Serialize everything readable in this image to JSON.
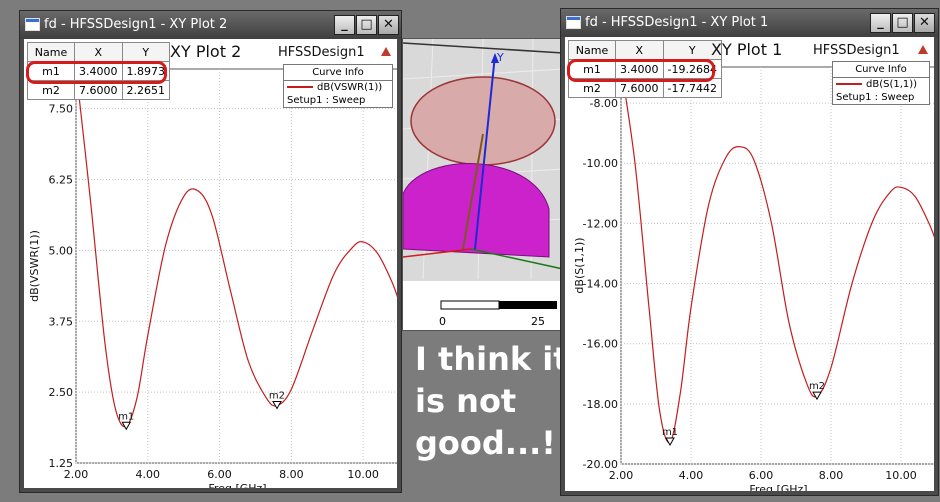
{
  "windows": [
    {
      "title": "fd - HFSSDesign1 - XY Plot 2",
      "plot_title": "XY Plot 2",
      "design": "HFSSDesign1",
      "markers": {
        "headers": [
          "Name",
          "X",
          "Y"
        ],
        "rows": [
          [
            "m1",
            "3.4000",
            "1.8973"
          ],
          [
            "m2",
            "7.6000",
            "2.2651"
          ]
        ],
        "highlighted_row": "m1",
        "highlight_color": "#d61b1b"
      },
      "curve_info": {
        "header": "Curve Info",
        "trace": "dB(VSWR(1))",
        "setup": "Setup1 : Sweep"
      }
    },
    {
      "title": "fd - HFSSDesign1 - XY Plot 1",
      "plot_title": "XY Plot 1",
      "design": "HFSSDesign1",
      "markers": {
        "headers": [
          "Name",
          "X",
          "Y"
        ],
        "rows": [
          [
            "m1",
            "3.4000",
            "-19.2684"
          ],
          [
            "m2",
            "7.6000",
            "-17.7442"
          ]
        ],
        "highlighted_row": "m1",
        "highlight_color": "#d61b1b"
      },
      "curve_info": {
        "header": "Curve Info",
        "trace": "dB(S(1,1))",
        "setup": "Setup1 : Sweep"
      }
    }
  ],
  "chart_data": [
    {
      "type": "line",
      "xlabel": "Freq [GHz]",
      "ylabel": "dB(VSWR(1))",
      "xlim": [
        2.0,
        11.0
      ],
      "ylim": [
        1.25,
        8.2
      ],
      "xticks": [
        "2.00",
        "4.00",
        "6.00",
        "8.00",
        "10.00"
      ],
      "yticks": [
        "1.25",
        "2.50",
        "3.75",
        "5.00",
        "6.25",
        "7.50"
      ],
      "grid": true,
      "line_color": "#c31d1d",
      "series": [
        {
          "name": "dB(VSWR(1))",
          "x": [
            2.0,
            2.4,
            2.8,
            3.1,
            3.4,
            3.7,
            4.0,
            4.5,
            5.0,
            5.4,
            5.8,
            6.3,
            6.8,
            7.3,
            7.6,
            8.0,
            8.6,
            9.2,
            9.7,
            10.0,
            10.4,
            10.8,
            11.0
          ],
          "y": [
            8.2,
            5.9,
            3.4,
            2.2,
            1.8973,
            2.4,
            3.5,
            5.1,
            5.95,
            6.05,
            5.6,
            4.3,
            3.05,
            2.4,
            2.2651,
            2.55,
            3.6,
            4.6,
            5.05,
            5.15,
            4.95,
            4.45,
            4.1
          ]
        }
      ],
      "markers": [
        {
          "label": "m1",
          "x": 3.4,
          "y": 1.8973
        },
        {
          "label": "m2",
          "x": 7.6,
          "y": 2.2651
        }
      ]
    },
    {
      "type": "line",
      "xlabel": "Freq [GHz]",
      "ylabel": "dB(S(1,1))",
      "xlim": [
        2.0,
        11.0
      ],
      "ylim": [
        -20.0,
        -6.8
      ],
      "xticks": [
        "2.00",
        "4.00",
        "6.00",
        "8.00",
        "10.00"
      ],
      "yticks": [
        "-20.00",
        "-18.00",
        "-16.00",
        "-14.00",
        "-12.00",
        "-10.00",
        "-8.00"
      ],
      "grid": true,
      "line_color": "#c31d1d",
      "series": [
        {
          "name": "dB(S(1,1))",
          "x": [
            2.0,
            2.4,
            2.8,
            3.1,
            3.4,
            3.7,
            4.0,
            4.5,
            5.0,
            5.4,
            5.8,
            6.3,
            6.8,
            7.3,
            7.6,
            8.0,
            8.6,
            9.2,
            9.7,
            10.0,
            10.4,
            10.8,
            11.0
          ],
          "y": [
            -6.8,
            -10.0,
            -14.8,
            -18.2,
            -19.2684,
            -17.6,
            -14.8,
            -11.4,
            -9.8,
            -9.45,
            -9.9,
            -12.0,
            -15.3,
            -17.3,
            -17.7442,
            -16.8,
            -14.0,
            -11.9,
            -10.95,
            -10.8,
            -11.1,
            -12.0,
            -12.6
          ]
        }
      ],
      "markers": [
        {
          "label": "m1",
          "x": 3.4,
          "y": -19.2684
        },
        {
          "label": "m2",
          "x": 7.6,
          "y": -17.7442
        }
      ]
    }
  ],
  "model_view": {
    "axis_label": "Y",
    "scale_labels": [
      "0",
      "25"
    ]
  },
  "caption_lines": [
    "I think it",
    "is not",
    "good...!!"
  ]
}
